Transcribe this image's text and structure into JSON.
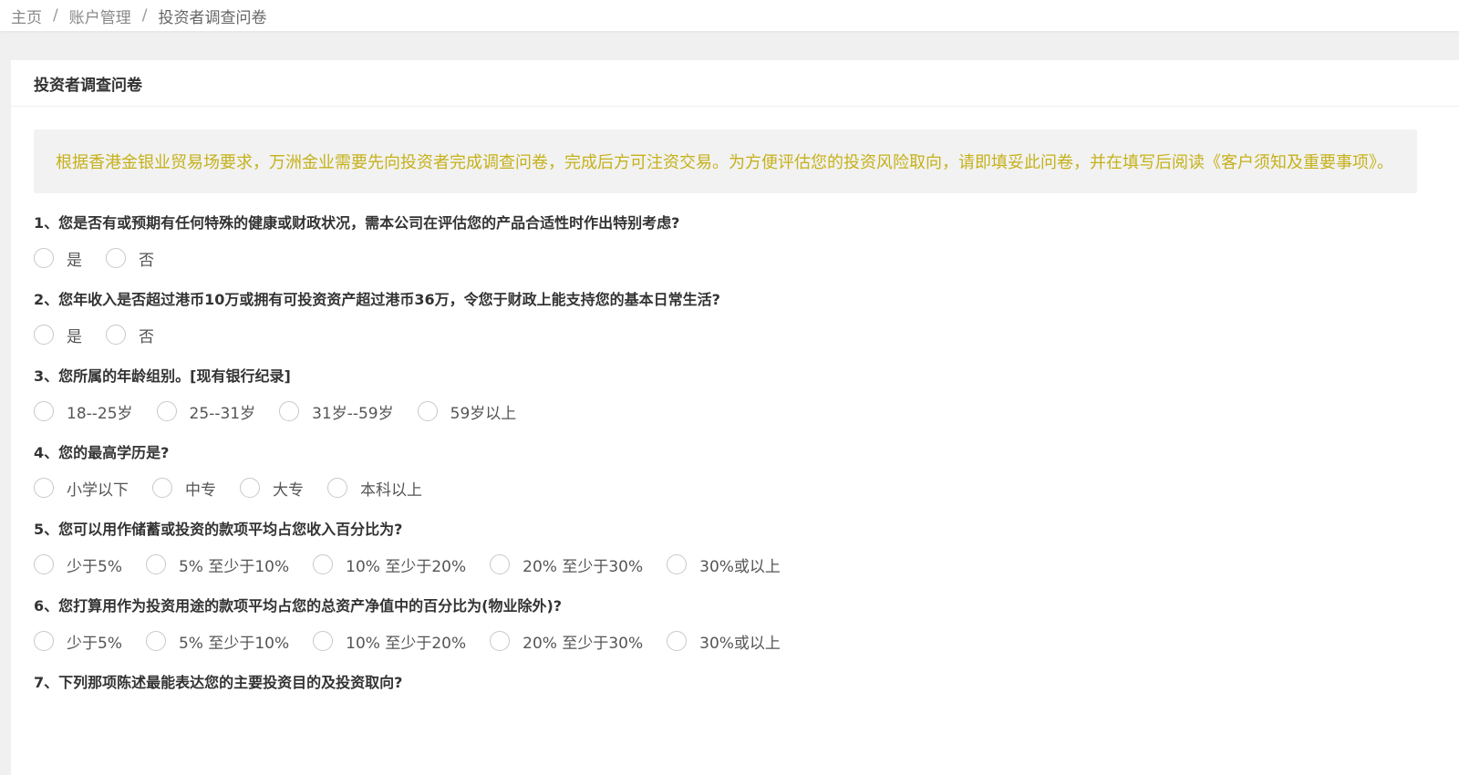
{
  "breadcrumb": {
    "items": [
      "主页",
      "账户管理",
      "投资者调查问卷"
    ],
    "separator": "/"
  },
  "card": {
    "title": "投资者调查问卷",
    "notice": "根据香港金银业贸易场要求，万洲金业需要先向投资者完成调查问卷，完成后方可注资交易。为方便评估您的投资风险取向，请即填妥此问卷，并在填写后阅读《客户须知及重要事项》。"
  },
  "questions": [
    {
      "title": "1、您是否有或预期有任何特殊的健康或财政状况，需本公司在评估您的产品合适性时作出特别考虑?",
      "options": [
        "是",
        "否"
      ]
    },
    {
      "title": "2、您年收入是否超过港币10万或拥有可投资资产超过港币36万，令您于财政上能支持您的基本日常生活?",
      "options": [
        "是",
        "否"
      ]
    },
    {
      "title": "3、您所属的年龄组别。[现有银行纪录]",
      "options": [
        "18--25岁",
        "25--31岁",
        "31岁--59岁",
        "59岁以上"
      ]
    },
    {
      "title": "4、您的最高学历是?",
      "options": [
        "小学以下",
        "中专",
        "大专",
        "本科以上"
      ]
    },
    {
      "title": "5、您可以用作储蓄或投资的款项平均占您收入百分比为?",
      "options": [
        "少于5%",
        "5% 至少于10%",
        "10% 至少于20%",
        "20% 至少于30%",
        "30%或以上"
      ]
    },
    {
      "title": "6、您打算用作为投资用途的款项平均占您的总资产净值中的百分比为(物业除外)?",
      "options": [
        "少于5%",
        "5% 至少于10%",
        "10% 至少于20%",
        "20% 至少于30%",
        "30%或以上"
      ]
    },
    {
      "title": "7、下列那项陈述最能表达您的主要投资目的及投资取向?",
      "options": []
    }
  ],
  "colors": {
    "notice_text": "#c5b11a",
    "notice_bg": "#f2f2f2",
    "page_bg": "#f0f0f0"
  }
}
